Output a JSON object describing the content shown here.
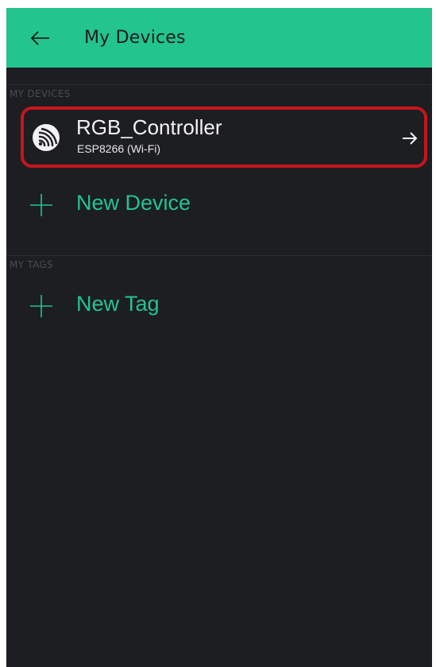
{
  "header": {
    "back_icon": "arrow-left-icon",
    "title": "My Devices",
    "accent": "#23c48e"
  },
  "sections": {
    "devices_label": "MY DEVICES",
    "tags_label": "MY TAGS"
  },
  "device": {
    "icon": "espressif-icon",
    "name": "RGB_Controller",
    "subtitle": "ESP8266 (Wi-Fi)",
    "action_icon": "arrow-right-icon",
    "highlight": "#c4161c"
  },
  "actions": {
    "new_device_label": "New Device",
    "new_tag_label": "New Tag",
    "icon": "plus-icon"
  }
}
